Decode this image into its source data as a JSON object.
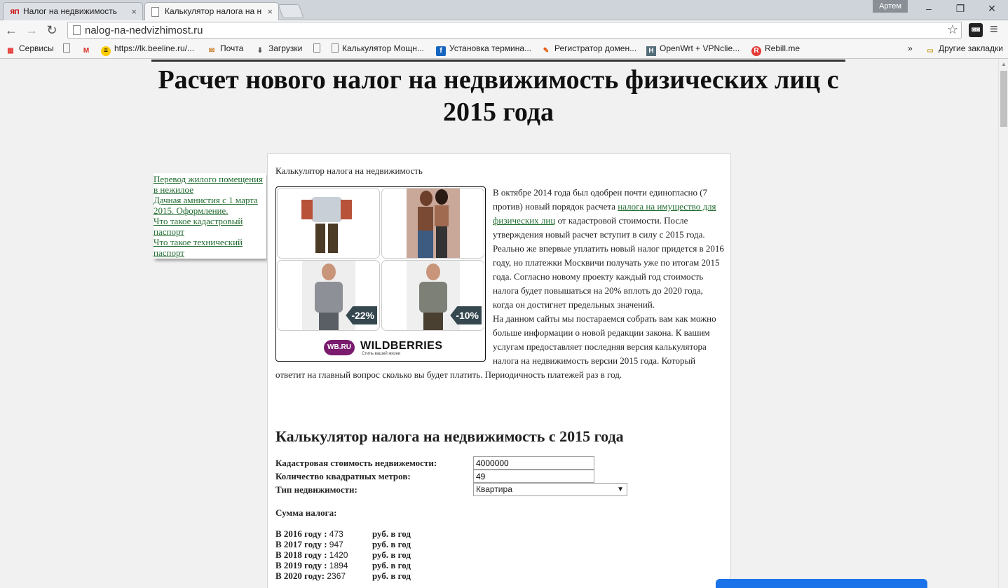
{
  "browser": {
    "tabs": [
      {
        "label": "Налог на недвижимость",
        "icon": "yandex-icon"
      },
      {
        "label": "Калькулятор налога на н",
        "icon": "page-icon"
      }
    ],
    "user": "Артем",
    "url": "nalog-na-nedvizhimost.ru",
    "bookmarks": [
      "Сервисы",
      "",
      "https://lk.beeline.ru/...",
      "Почта",
      "Загрузки",
      "",
      "Калькулятор Мощн...",
      "Установка термина...",
      "Регистратор домен...",
      "OpenWrt + VPNclie...",
      "Rebill.me"
    ],
    "bookmarks_more": "»",
    "other_bookmarks": "Другие закладки"
  },
  "page": {
    "title": "Расчет нового налог на недвижимость физических лиц с 2015 года",
    "sidebar_links": [
      "Перевод жилого помещения в нежилое",
      "Дачная амнистия с 1 марта 2015. Оформление.",
      "Что такое кадастровый паспорт",
      "Что такое технический паспорт"
    ],
    "lead": "Калькулятор налога на недвижимость",
    "ad": {
      "discounts": [
        "-22%",
        "-10%"
      ],
      "brand": "WILDBERRIES",
      "badge": "WB.RU",
      "tagline": "Стиль вашей жизни"
    },
    "article": {
      "p1_before": "В октябре 2014 года был одобрен почти единогласно (7 против) новый порядок расчета ",
      "p1_link": "налога на имущество для физических лиц",
      "p1_after": " от кадастровой стоимости. После утверждения новый расчет вступит в силу с 2015 года. Реально же впервые уплатить новый налог придется в 2016 году, но платежки Москвичи получать уже по итогам 2015 года. Согласно новому проекту каждый год стоимость налога будет повышаться на 20% вплоть до 2020 года, когда он достигнет предельных значений.",
      "p2": "На данном сайты мы постараемся собрать вам как можно больше информации о новой редакции закона. К вашим услугам предоставляет последняя версия калькулятора налога на недвижимость версии 2015 года. Который ответит на главный вопрос сколько вы будет платить. Периодичность платежей раз в год."
    },
    "calculator": {
      "title": "Калькулятор налога на недвижимость с 2015 года",
      "fields": [
        {
          "label": "Кадастровая стоимость недвижемости:",
          "value": "4000000"
        },
        {
          "label": "Количество квадратных метров:",
          "value": "49"
        }
      ],
      "type_label": "Тип недвижимости:",
      "type_value": "Квартира",
      "sum_title": "Сумма налога:",
      "years": [
        {
          "label": "В 2016 году :",
          "value": "473",
          "unit": "руб. в год"
        },
        {
          "label": "В 2017 году :",
          "value": "947",
          "unit": "руб. в год"
        },
        {
          "label": "В 2018 году :",
          "value": "1420",
          "unit": "руб. в год"
        },
        {
          "label": "В 2019 году :",
          "value": "1894",
          "unit": "руб. в год"
        },
        {
          "label": "В 2020 году:",
          "value": "2367",
          "unit": "руб. в год"
        }
      ]
    }
  },
  "colors": {
    "link": "#1f6a2e",
    "chat": "#1a73e8",
    "adchoices": "#29b6f6",
    "ad_discount": "#35474f"
  }
}
